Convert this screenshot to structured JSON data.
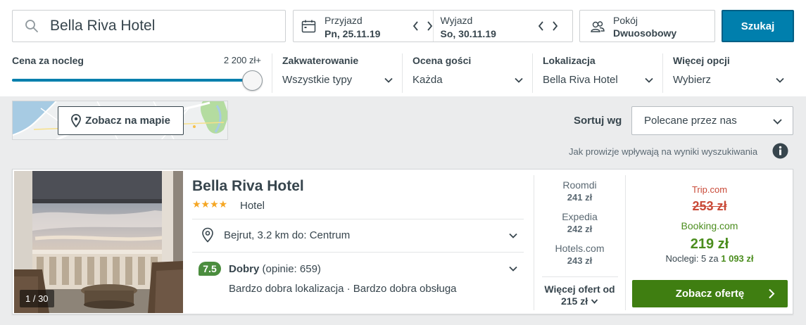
{
  "search": {
    "value": "Bella Riva Hotel",
    "icon": "search-icon"
  },
  "dates": {
    "checkin": {
      "label": "Przyjazd",
      "value": "Pn, 25.11.19"
    },
    "checkout": {
      "label": "Wyjazd",
      "value": "So, 30.11.19"
    }
  },
  "room": {
    "label": "Pokój",
    "value": "Dwuosobowy"
  },
  "search_button": "Szukaj",
  "filters": {
    "price": {
      "title": "Cena za nocleg",
      "max": "2 200 zł+",
      "level": 1.0
    },
    "accommodation": {
      "title": "Zakwaterowanie",
      "value": "Wszystkie typy"
    },
    "guest_rating": {
      "title": "Ocena gości",
      "value": "Każda"
    },
    "location": {
      "title": "Lokalizacja",
      "value": "Bella Riva Hotel"
    },
    "more": {
      "title": "Więcej opcji",
      "value": "Wybierz"
    }
  },
  "map_button": "Zobacz na mapie",
  "sort": {
    "label": "Sortuj wg",
    "value": "Polecane przez nas"
  },
  "disclaimer": "Jak prowizje wpływają na wyniki wyszukiwania",
  "hotel": {
    "name": "Bella Riva Hotel",
    "stars": "★★★★",
    "star_count": 4,
    "type": "Hotel",
    "location": "Bejrut, 3.2 km do: Centrum",
    "rating_score": "7.5",
    "rating_word": "Dobry",
    "rating_count": "(opinie: 659)",
    "highlights": "Bardzo dobra lokalizacja · Bardzo dobra obsługa",
    "photo_count": "1 / 30",
    "providers": [
      {
        "name": "Roomdi",
        "price": "241 zł"
      },
      {
        "name": "Expedia",
        "price": "242 zł"
      },
      {
        "name": "Hotels.com",
        "price": "243 zł"
      }
    ],
    "more_offers_label": "Więcej ofert od",
    "more_offers_price": "215 zł",
    "deal": {
      "old_provider": "Trip.com",
      "old_price": "253 zł",
      "provider": "Booking.com",
      "price": "219 zł",
      "nights_label": "Noclegi: 5 za",
      "nights_total": "1 093 zł"
    },
    "cta": "Zobacz ofertę"
  },
  "colors": {
    "accent": "#007fad",
    "deal_green": "#3f7e11",
    "rating_green": "#4b8d3e",
    "strike_red": "#c94a38",
    "star": "#f5a623"
  }
}
